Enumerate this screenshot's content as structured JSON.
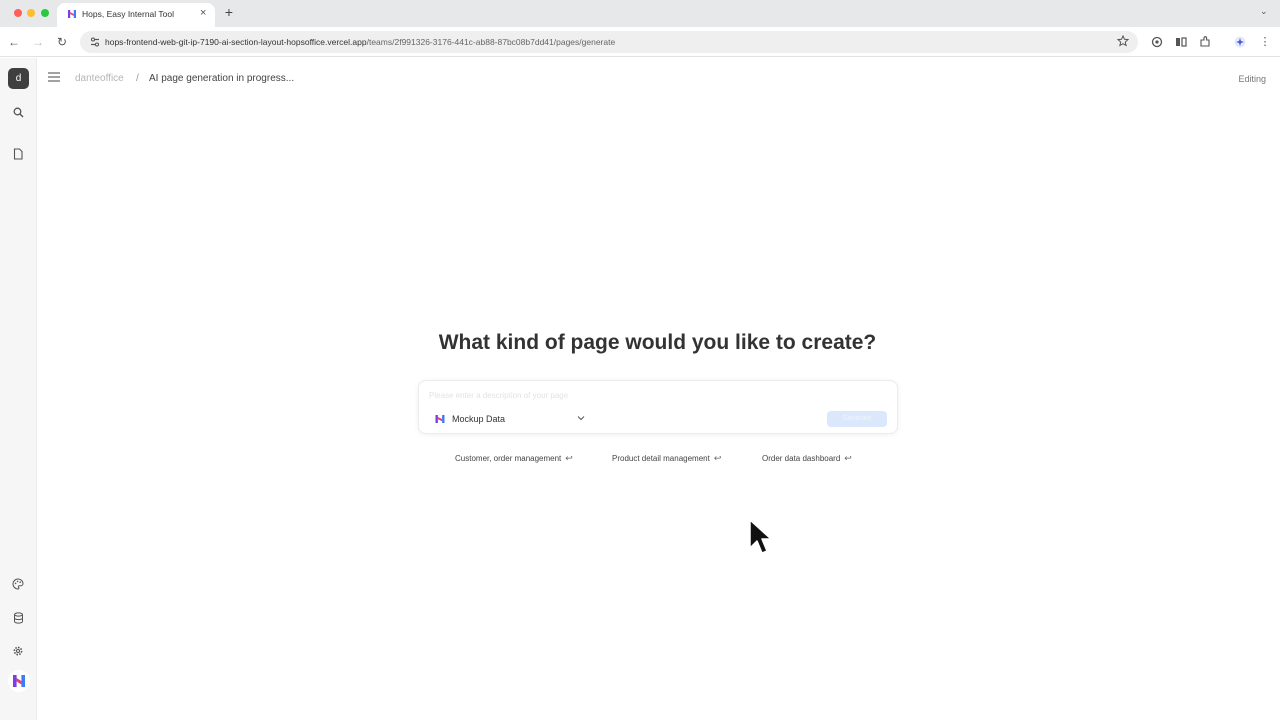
{
  "browser": {
    "tab_title": "Hops, Easy Internal Tool",
    "tab_close": "×",
    "new_tab": "+",
    "tabs_menu": "⌄",
    "url_host": "hops-frontend-web-git-ip-7190-ai-section-layout-hopsoffice.vercel.app",
    "url_path": "/teams/2f991326-3176-441c-ab88-87bc08b7dd41/pages/generate",
    "back": "←",
    "forward": "→",
    "reload": "↻"
  },
  "sidebar": {
    "avatar_letter": "d"
  },
  "topbar": {
    "team": "danteoffice",
    "separator": "/",
    "page_title": "AI page generation in progress...",
    "status": "Editing"
  },
  "main": {
    "headline": "What kind of page would you like to create?",
    "prompt_placeholder": "Please enter a description of your page",
    "data_source": "Mockup Data",
    "submit_label": "Generate",
    "suggestions": [
      {
        "label": "Customer, order management",
        "enter": "↩"
      },
      {
        "label": "Product detail management",
        "enter": "↩"
      },
      {
        "label": "Order data dashboard",
        "enter": "↩"
      }
    ]
  },
  "colors": {
    "accent": "#dbe8fb",
    "brand_purple": "#7b3fe4",
    "brand_pink": "#e8406f",
    "brand_blue": "#3b7cf5"
  }
}
